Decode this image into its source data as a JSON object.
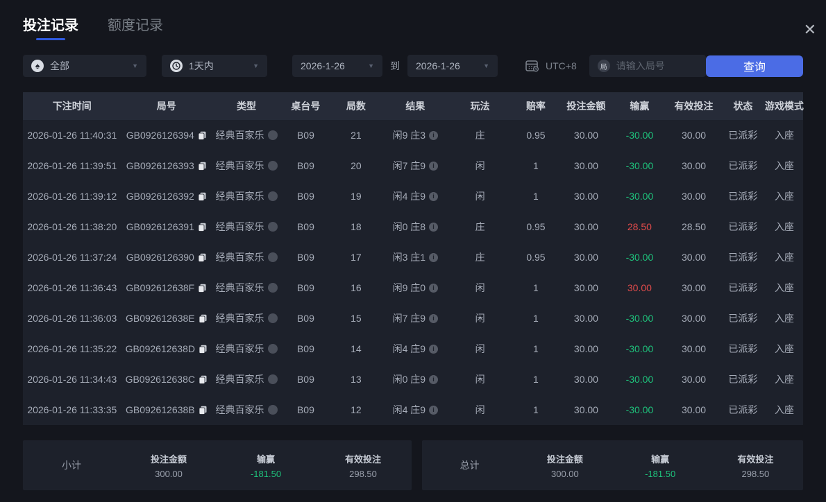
{
  "window": {
    "close_icon": "✕"
  },
  "tabs": [
    {
      "label": "投注记录",
      "active": true
    },
    {
      "label": "额度记录",
      "active": false
    }
  ],
  "filters": {
    "game_type": {
      "value": "全部",
      "icon": "spade-icon"
    },
    "time_range": {
      "value": "1天内",
      "icon": "clock-icon"
    },
    "date_from": "2026-1-26",
    "to_label": "到",
    "date_to": "2026-1-26",
    "timezone": "UTC+8",
    "round_input_placeholder": "请输入局号",
    "round_input_icon_char": "局",
    "search_button": "查询"
  },
  "table": {
    "columns": [
      {
        "key": "time",
        "label": "下注时间"
      },
      {
        "key": "round_id",
        "label": "局号"
      },
      {
        "key": "game_type",
        "label": "类型"
      },
      {
        "key": "table_no",
        "label": "桌台号"
      },
      {
        "key": "round_no",
        "label": "局数"
      },
      {
        "key": "result",
        "label": "结果"
      },
      {
        "key": "play",
        "label": "玩法"
      },
      {
        "key": "odds",
        "label": "赔率"
      },
      {
        "key": "bet_amount",
        "label": "投注金额"
      },
      {
        "key": "win_loss",
        "label": "输赢"
      },
      {
        "key": "valid_bet",
        "label": "有效投注"
      },
      {
        "key": "status",
        "label": "状态"
      },
      {
        "key": "mode",
        "label": "游戏模式"
      }
    ],
    "rows": [
      {
        "time": "2026-01-26 11:40:31",
        "round_id": "GB0926126394",
        "game_type": "经典百家乐",
        "table_no": "B09",
        "round_no": "21",
        "result": "闲9 庄3",
        "play": "庄",
        "odds": "0.95",
        "bet_amount": "30.00",
        "win_loss": "-30.00",
        "valid_bet": "30.00",
        "status": "已派彩",
        "mode": "入座"
      },
      {
        "time": "2026-01-26 11:39:51",
        "round_id": "GB0926126393",
        "game_type": "经典百家乐",
        "table_no": "B09",
        "round_no": "20",
        "result": "闲7 庄9",
        "play": "闲",
        "odds": "1",
        "bet_amount": "30.00",
        "win_loss": "-30.00",
        "valid_bet": "30.00",
        "status": "已派彩",
        "mode": "入座"
      },
      {
        "time": "2026-01-26 11:39:12",
        "round_id": "GB0926126392",
        "game_type": "经典百家乐",
        "table_no": "B09",
        "round_no": "19",
        "result": "闲4 庄9",
        "play": "闲",
        "odds": "1",
        "bet_amount": "30.00",
        "win_loss": "-30.00",
        "valid_bet": "30.00",
        "status": "已派彩",
        "mode": "入座"
      },
      {
        "time": "2026-01-26 11:38:20",
        "round_id": "GB0926126391",
        "game_type": "经典百家乐",
        "table_no": "B09",
        "round_no": "18",
        "result": "闲0 庄8",
        "play": "庄",
        "odds": "0.95",
        "bet_amount": "30.00",
        "win_loss": "28.50",
        "valid_bet": "28.50",
        "status": "已派彩",
        "mode": "入座"
      },
      {
        "time": "2026-01-26 11:37:24",
        "round_id": "GB0926126390",
        "game_type": "经典百家乐",
        "table_no": "B09",
        "round_no": "17",
        "result": "闲3 庄1",
        "play": "庄",
        "odds": "0.95",
        "bet_amount": "30.00",
        "win_loss": "-30.00",
        "valid_bet": "30.00",
        "status": "已派彩",
        "mode": "入座"
      },
      {
        "time": "2026-01-26 11:36:43",
        "round_id": "GB092612638F",
        "game_type": "经典百家乐",
        "table_no": "B09",
        "round_no": "16",
        "result": "闲9 庄0",
        "play": "闲",
        "odds": "1",
        "bet_amount": "30.00",
        "win_loss": "30.00",
        "valid_bet": "30.00",
        "status": "已派彩",
        "mode": "入座"
      },
      {
        "time": "2026-01-26 11:36:03",
        "round_id": "GB092612638E",
        "game_type": "经典百家乐",
        "table_no": "B09",
        "round_no": "15",
        "result": "闲7 庄9",
        "play": "闲",
        "odds": "1",
        "bet_amount": "30.00",
        "win_loss": "-30.00",
        "valid_bet": "30.00",
        "status": "已派彩",
        "mode": "入座"
      },
      {
        "time": "2026-01-26 11:35:22",
        "round_id": "GB092612638D",
        "game_type": "经典百家乐",
        "table_no": "B09",
        "round_no": "14",
        "result": "闲4 庄9",
        "play": "闲",
        "odds": "1",
        "bet_amount": "30.00",
        "win_loss": "-30.00",
        "valid_bet": "30.00",
        "status": "已派彩",
        "mode": "入座"
      },
      {
        "time": "2026-01-26 11:34:43",
        "round_id": "GB092612638C",
        "game_type": "经典百家乐",
        "table_no": "B09",
        "round_no": "13",
        "result": "闲0 庄9",
        "play": "闲",
        "odds": "1",
        "bet_amount": "30.00",
        "win_loss": "-30.00",
        "valid_bet": "30.00",
        "status": "已派彩",
        "mode": "入座"
      },
      {
        "time": "2026-01-26 11:33:35",
        "round_id": "GB092612638B",
        "game_type": "经典百家乐",
        "table_no": "B09",
        "round_no": "12",
        "result": "闲4 庄9",
        "play": "闲",
        "odds": "1",
        "bet_amount": "30.00",
        "win_loss": "-30.00",
        "valid_bet": "30.00",
        "status": "已派彩",
        "mode": "入座"
      }
    ]
  },
  "summary": {
    "subtotal": {
      "label": "小计",
      "bet_amount_label": "投注金额",
      "bet_amount": "300.00",
      "win_loss_label": "输赢",
      "win_loss": "-181.50",
      "valid_bet_label": "有效投注",
      "valid_bet": "298.50"
    },
    "total": {
      "label": "总计",
      "bet_amount_label": "投注金额",
      "bet_amount": "300.00",
      "win_loss_label": "输赢",
      "win_loss": "-181.50",
      "valid_bet_label": "有效投注",
      "valid_bet": "298.50"
    }
  },
  "colors": {
    "accent_blue": "#4b6ce5",
    "loss_green": "#1ec37c",
    "win_red": "#e04b4b",
    "tab_underline_blue": "#2f5ae0"
  }
}
